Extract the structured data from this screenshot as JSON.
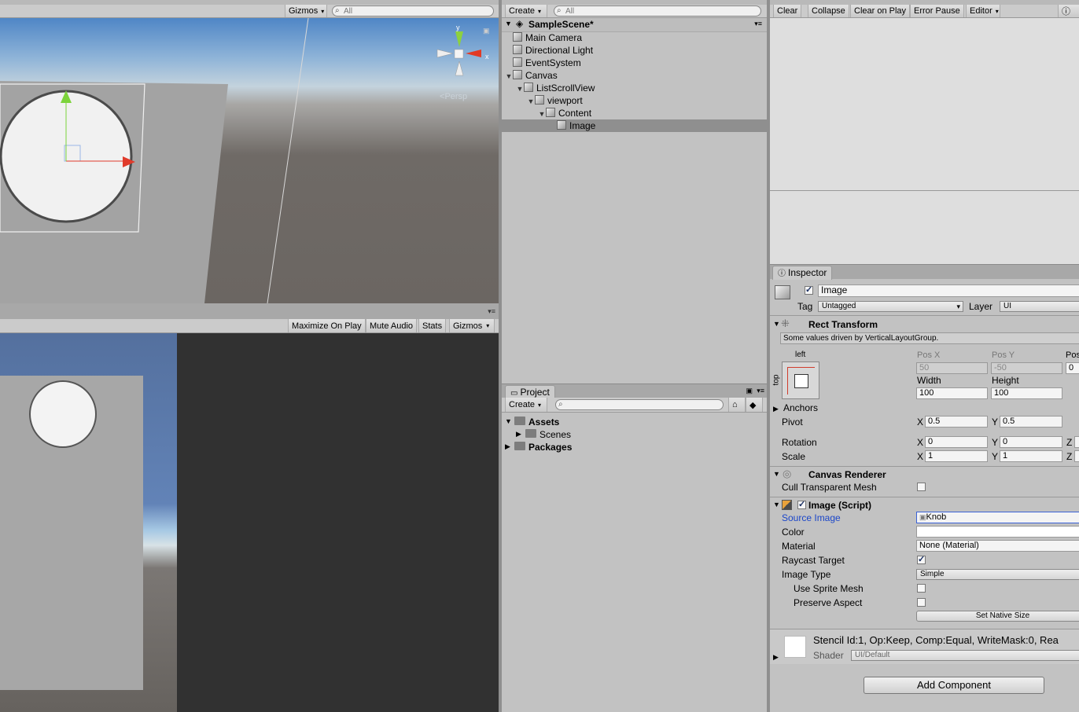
{
  "scene_view": {
    "gizmos_label": "Gizmos",
    "search_placeholder": "All",
    "axis_y": "y",
    "axis_x": "x",
    "persp_label": "Persp"
  },
  "game_view": {
    "buttons": [
      "Maximize On Play",
      "Mute Audio",
      "Stats",
      "Gizmos"
    ]
  },
  "hierarchy": {
    "create_label": "Create",
    "search_placeholder": "All",
    "scene_name": "SampleScene*",
    "items": [
      {
        "label": "Main Camera",
        "depth": 1,
        "expanded": null
      },
      {
        "label": "Directional Light",
        "depth": 1,
        "expanded": null
      },
      {
        "label": "EventSystem",
        "depth": 1,
        "expanded": null
      },
      {
        "label": "Canvas",
        "depth": 1,
        "expanded": true
      },
      {
        "label": "ListScrollView",
        "depth": 2,
        "expanded": true
      },
      {
        "label": "viewport",
        "depth": 3,
        "expanded": true
      },
      {
        "label": "Content",
        "depth": 4,
        "expanded": true
      },
      {
        "label": "Image",
        "depth": 5,
        "expanded": null,
        "selected": true
      }
    ]
  },
  "project": {
    "tab_label": "Project",
    "create_label": "Create",
    "items": [
      {
        "label": "Assets",
        "bold": true
      },
      {
        "label": "Scenes",
        "bold": false
      },
      {
        "label": "Packages",
        "bold": true
      }
    ]
  },
  "console": {
    "buttons": [
      "Clear",
      "Collapse",
      "Clear on Play",
      "Error Pause",
      "Editor"
    ]
  },
  "inspector": {
    "tab_label": "Inspector",
    "object_name": "Image",
    "tag_label": "Tag",
    "tag_value": "Untagged",
    "layer_label": "Layer",
    "layer_value": "UI",
    "rect_transform": {
      "title": "Rect Transform",
      "driven_note": "Some values driven by VerticalLayoutGroup.",
      "anchor_h": "left",
      "anchor_v": "top",
      "pos_x_label": "Pos X",
      "pos_x": "50",
      "pos_y_label": "Pos Y",
      "pos_y": "-50",
      "pos_z_label": "Pos Z",
      "pos_z": "0",
      "width_label": "Width",
      "width": "100",
      "height_label": "Height",
      "height": "100",
      "anchors_label": "Anchors",
      "pivot_label": "Pivot",
      "pivot_x": "0.5",
      "pivot_y": "0.5",
      "rotation_label": "Rotation",
      "rot_x": "0",
      "rot_y": "0",
      "scale_label": "Scale",
      "scale_x": "1",
      "scale_y": "1",
      "x_label": "X",
      "y_label": "Y",
      "z_label": "Z"
    },
    "canvas_renderer": {
      "title": "Canvas Renderer",
      "cull_label": "Cull Transparent Mesh"
    },
    "image_script": {
      "title": "Image (Script)",
      "source_image_label": "Source Image",
      "source_image_value": "Knob",
      "color_label": "Color",
      "material_label": "Material",
      "material_value": "None (Material)",
      "raycast_label": "Raycast Target",
      "image_type_label": "Image Type",
      "image_type_value": "Simple",
      "use_sprite_mesh_label": "Use Sprite Mesh",
      "preserve_aspect_label": "Preserve Aspect",
      "set_native_size_label": "Set Native Size"
    },
    "material_preview": {
      "stencil_text": "Stencil Id:1, Op:Keep, Comp:Equal, WriteMask:0, Rea",
      "shader_label": "Shader",
      "shader_value": "UI/Default"
    },
    "add_component_label": "Add Component"
  },
  "colors": {
    "selection": "#8f8f8f",
    "link_blue": "#1b46c9",
    "dark_game_bg": "#313131"
  }
}
